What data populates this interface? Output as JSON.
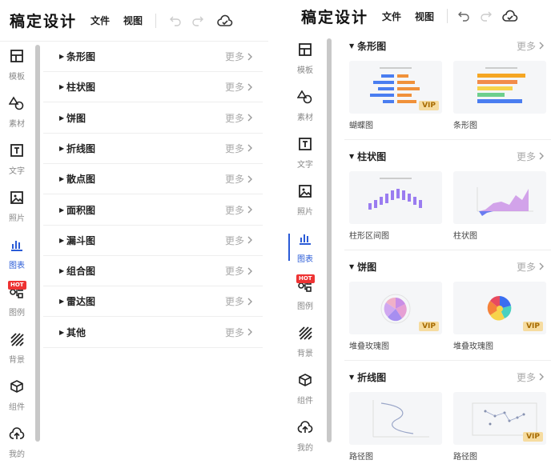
{
  "app": {
    "logo": "稿定设计",
    "menu_file": "文件",
    "menu_view": "视图"
  },
  "nav": [
    {
      "label": "模板",
      "icon": "template-icon"
    },
    {
      "label": "素材",
      "icon": "shapes-icon"
    },
    {
      "label": "文字",
      "icon": "text-icon"
    },
    {
      "label": "照片",
      "icon": "photo-icon"
    },
    {
      "label": "图表",
      "icon": "chart-icon",
      "active": true
    },
    {
      "label": "图例",
      "icon": "legend-icon",
      "badge": "HOT"
    },
    {
      "label": "背景",
      "icon": "background-icon"
    },
    {
      "label": "组件",
      "icon": "component-icon"
    },
    {
      "label": "我的",
      "icon": "upload-icon"
    }
  ],
  "categories": [
    "条形图",
    "柱状图",
    "饼图",
    "折线图",
    "散点图",
    "面积图",
    "漏斗图",
    "组合图",
    "雷达图",
    "其他"
  ],
  "more_label": "更多",
  "vip_label": "VIP",
  "sections": [
    {
      "title": "条形图",
      "cards": [
        {
          "name": "蝴蝶图",
          "vip": true
        },
        {
          "name": "条形图",
          "vip": false
        }
      ]
    },
    {
      "title": "柱状图",
      "cards": [
        {
          "name": "柱形区间图",
          "vip": false
        },
        {
          "name": "柱状图",
          "vip": false
        }
      ]
    },
    {
      "title": "饼图",
      "cards": [
        {
          "name": "堆叠玫瑰图",
          "vip": true
        },
        {
          "name": "堆叠玫瑰图",
          "vip": true
        }
      ]
    },
    {
      "title": "折线图",
      "cards": [
        {
          "name": "路径图",
          "vip": false
        },
        {
          "name": "路径图",
          "vip": true
        }
      ]
    }
  ],
  "colors": {
    "accent": "#2a5bd7",
    "hot": "#e33333",
    "vip_bg": "#f6dca0"
  }
}
